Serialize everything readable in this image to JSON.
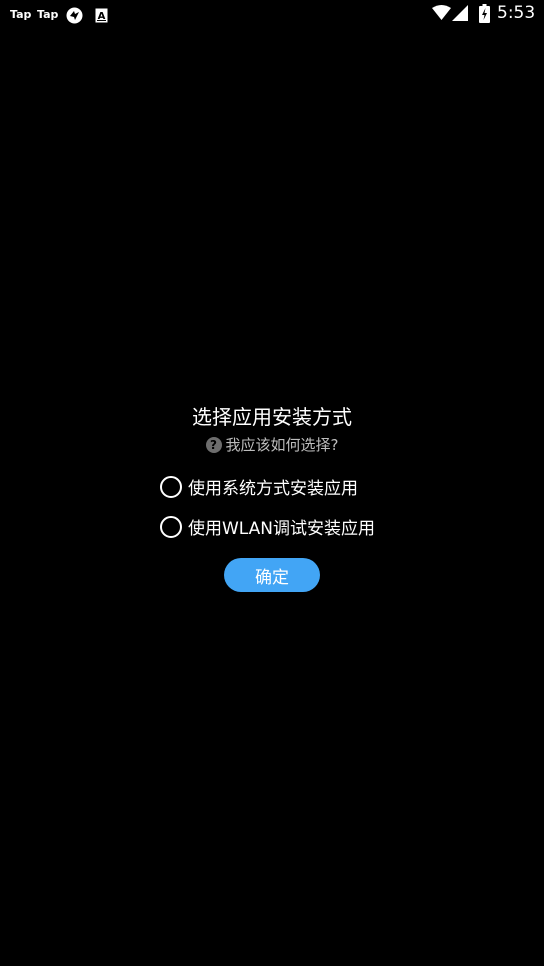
{
  "status_bar": {
    "notifications": [
      {
        "label": "Tap",
        "icon": "taptap-icon"
      },
      {
        "label": "Tap",
        "icon": "taptap-icon"
      },
      {
        "label": "",
        "icon": "share-icon"
      },
      {
        "label": "A",
        "icon": "a-box-icon"
      }
    ],
    "time": "5:53",
    "wifi_icon": "wifi-icon",
    "cell_icon": "cell-signal-icon",
    "battery_icon": "battery-charging-icon"
  },
  "dialog": {
    "title": "选择应用安装方式",
    "help_icon": "?",
    "help_text": "我应该如何选择?",
    "options": [
      {
        "label": "使用系统方式安装应用",
        "selected": false
      },
      {
        "label": "使用WLAN调试安装应用",
        "selected": false
      }
    ],
    "confirm_label": "确定",
    "accent_color": "#42a5f5"
  }
}
